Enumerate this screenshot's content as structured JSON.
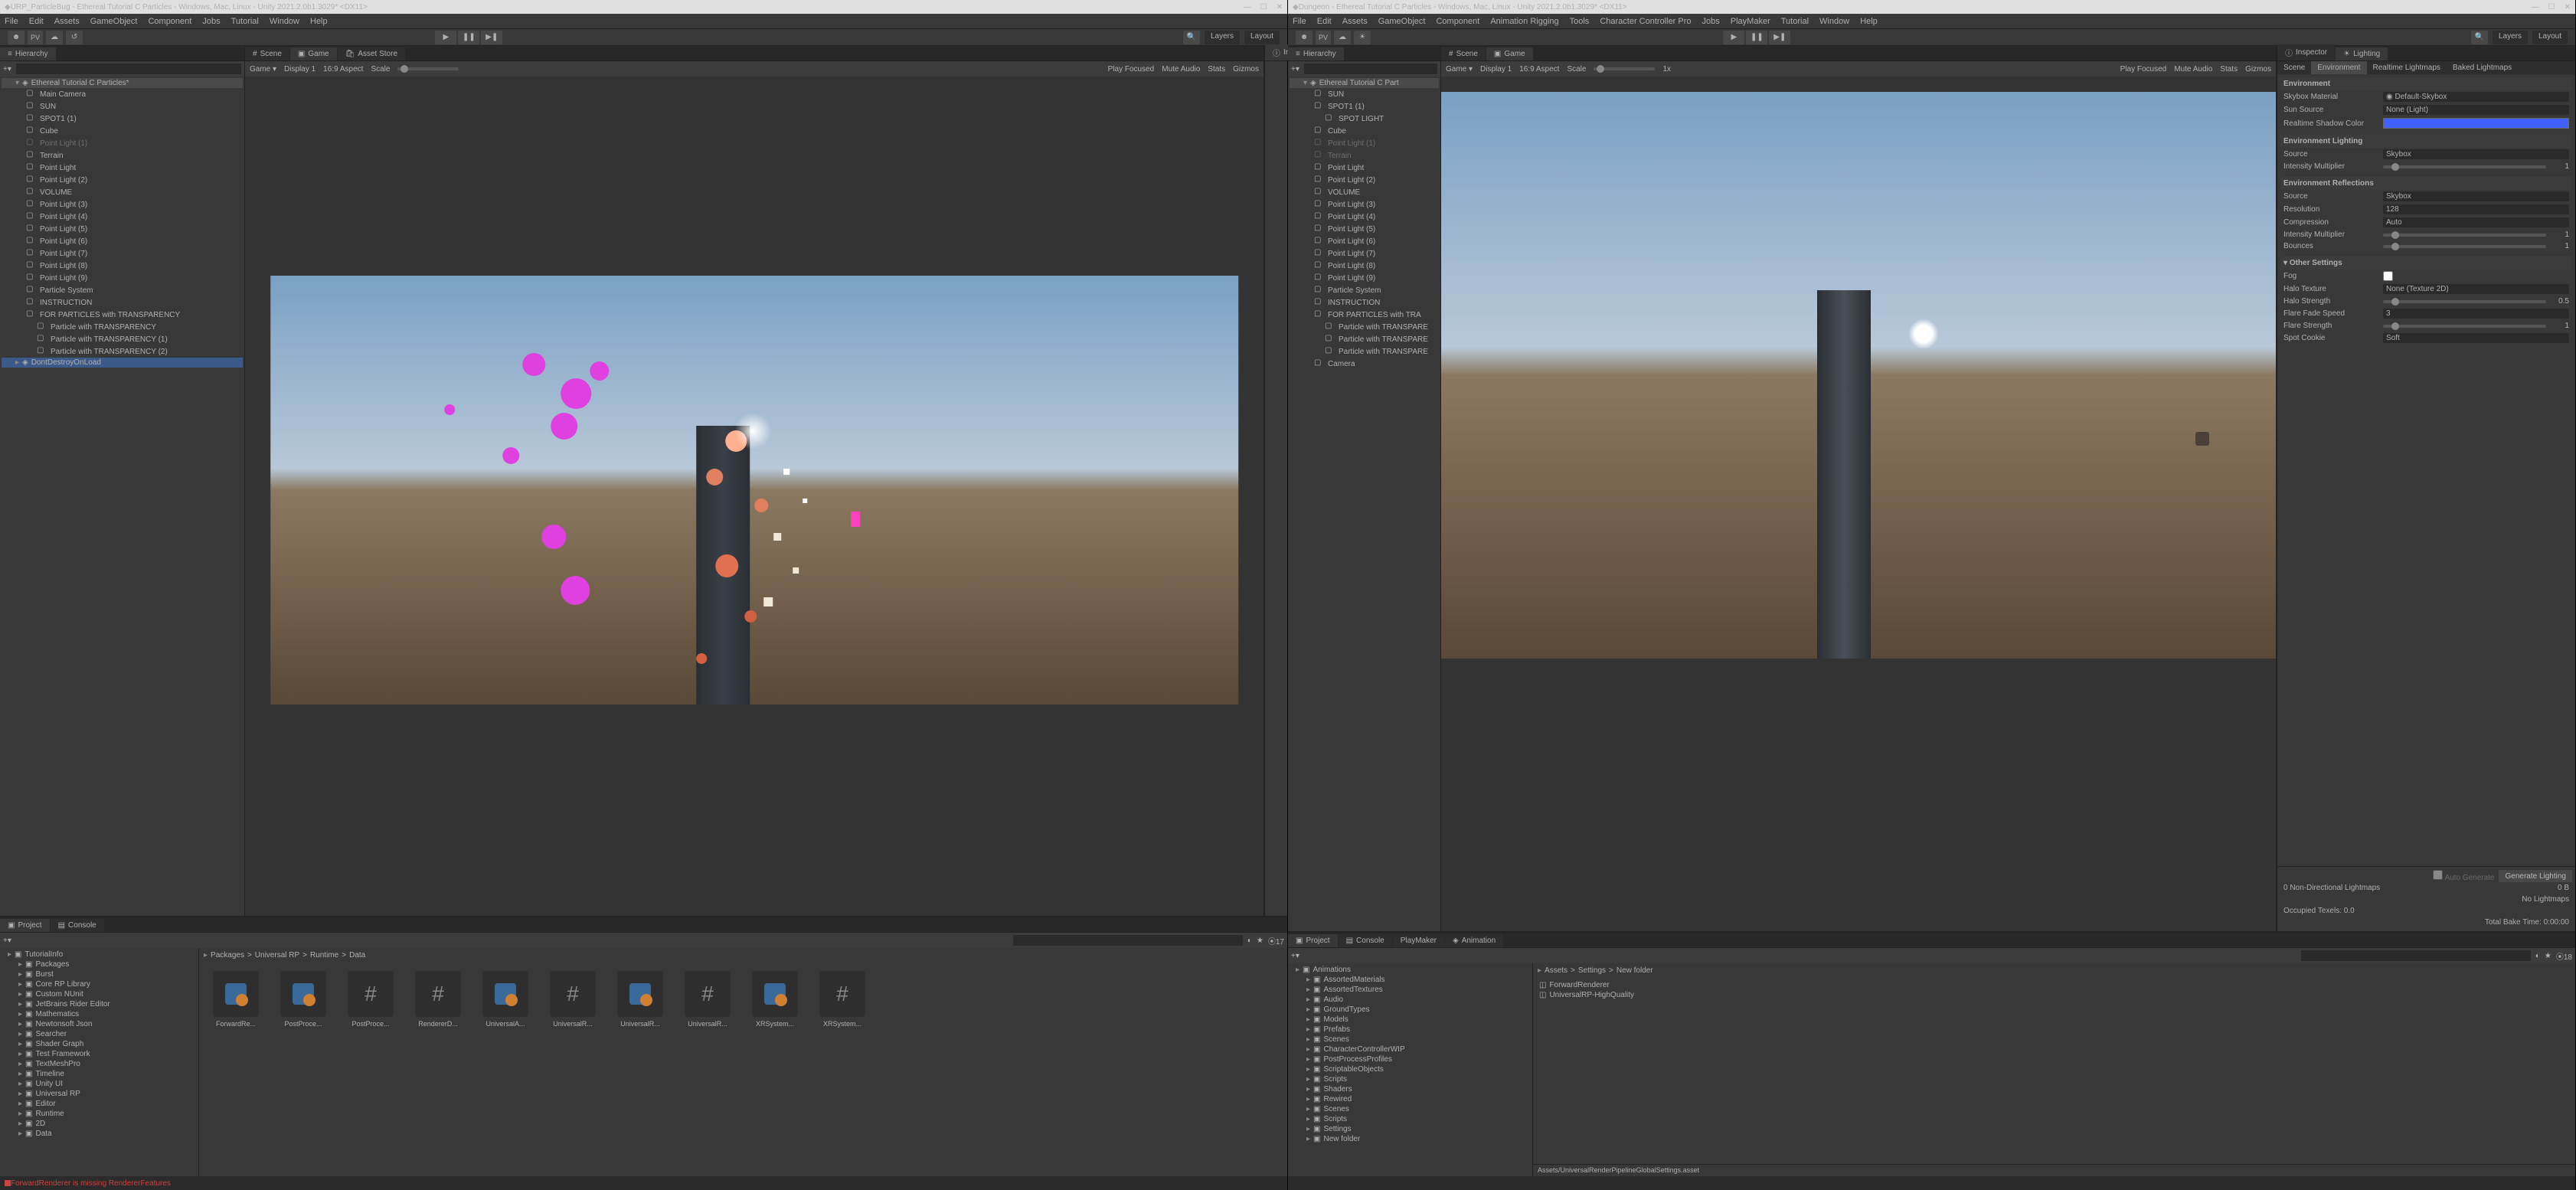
{
  "left": {
    "title": "URP_ParticleBug - Ethereal Tutorial C Particles - Windows, Mac, Linux - Unity 2021.2.0b1.3029* <DX11>",
    "menu": [
      "File",
      "Edit",
      "Assets",
      "GameObject",
      "Component",
      "Jobs",
      "Tutorial",
      "Window",
      "Help"
    ],
    "toolbar_right": {
      "layers": "Layers",
      "layout": "Layout"
    },
    "hierarchy": {
      "tab": "Hierarchy",
      "scene": "Ethereal Tutorial C Particles*",
      "items": [
        {
          "txt": "Main Camera",
          "l": 2
        },
        {
          "txt": "SUN",
          "l": 2
        },
        {
          "txt": "SPOT1 (1)",
          "l": 2
        },
        {
          "txt": "Cube",
          "l": 2
        },
        {
          "txt": "Point Light (1)",
          "l": 2,
          "dim": true
        },
        {
          "txt": "Terrain",
          "l": 2
        },
        {
          "txt": "Point Light",
          "l": 2
        },
        {
          "txt": "Point Light (2)",
          "l": 2
        },
        {
          "txt": "VOLUME",
          "l": 2
        },
        {
          "txt": "Point Light (3)",
          "l": 2
        },
        {
          "txt": "Point Light (4)",
          "l": 2
        },
        {
          "txt": "Point Light (5)",
          "l": 2
        },
        {
          "txt": "Point Light (6)",
          "l": 2
        },
        {
          "txt": "Point Light (7)",
          "l": 2
        },
        {
          "txt": "Point Light (8)",
          "l": 2
        },
        {
          "txt": "Point Light (9)",
          "l": 2
        },
        {
          "txt": "Particle System",
          "l": 2
        },
        {
          "txt": "INSTRUCTION",
          "l": 2
        },
        {
          "txt": "FOR PARTICLES with TRANSPARENCY",
          "l": 2
        },
        {
          "txt": "Particle with TRANSPARENCY",
          "l": 3
        },
        {
          "txt": "Particle with TRANSPARENCY (1)",
          "l": 3
        },
        {
          "txt": "Particle with TRANSPARENCY (2)",
          "l": 3
        }
      ],
      "dontdestroy": "DontDestroyOnLoad"
    },
    "view": {
      "tabs": [
        "Scene",
        "Game",
        "Asset Store"
      ],
      "toolbar": {
        "display": "Display 1",
        "aspect": "16:9 Aspect",
        "scale": "Scale",
        "play_focused": "Play Focused",
        "mute": "Mute Audio",
        "stats": "Stats",
        "gizmos": "Gizmos"
      }
    },
    "inspector": {
      "tab": "Inspector"
    },
    "project": {
      "tabs": [
        "Project",
        "Console"
      ],
      "breadcrumb": [
        "Packages",
        "Universal RP",
        "Runtime",
        "Data"
      ],
      "tree": [
        "TutorialInfo",
        "Packages",
        "Burst",
        "Core RP Library",
        "Custom NUnit",
        "JetBrains Rider Editor",
        "Mathematics",
        "Newtonsoft Json",
        "Searcher",
        "Shader Graph",
        "Test Framework",
        "TextMeshPro",
        "Timeline",
        "Unity UI",
        "Universal RP",
        "Editor",
        "Runtime",
        "2D",
        "Data"
      ],
      "assets": [
        "ForwardRe...",
        "PostProce...",
        "PostProce...",
        "RendererD...",
        "UniversalA...",
        "UniversalR...",
        "UniversalR...",
        "UniversalR...",
        "XRSystem...",
        "XRSystem..."
      ]
    },
    "status": "ForwardRenderer is missing RendererFeatures"
  },
  "right": {
    "title": "Dungeon - Ethereal Tutorial C Particles - Windows, Mac, Linux - Unity 2021.2.0b1.3029* <DX11>",
    "menu": [
      "File",
      "Edit",
      "Assets",
      "GameObject",
      "Component",
      "Animation Rigging",
      "Tools",
      "Character Controller Pro",
      "Jobs",
      "PlayMaker",
      "Tutorial",
      "Window",
      "Help"
    ],
    "toolbar_right": {
      "layers": "Layers",
      "layout": "Layout"
    },
    "hierarchy": {
      "tab": "Hierarchy",
      "scene": "Ethereal Tutorial C Part",
      "items": [
        {
          "txt": "SUN",
          "l": 2
        },
        {
          "txt": "SPOT1 (1)",
          "l": 2
        },
        {
          "txt": "SPOT LIGHT",
          "l": 3
        },
        {
          "txt": "Cube",
          "l": 2
        },
        {
          "txt": "Point Light (1)",
          "l": 2,
          "dim": true
        },
        {
          "txt": "Terrain",
          "l": 2,
          "dim": true
        },
        {
          "txt": "Point Light",
          "l": 2
        },
        {
          "txt": "Point Light (2)",
          "l": 2
        },
        {
          "txt": "VOLUME",
          "l": 2
        },
        {
          "txt": "Point Light (3)",
          "l": 2
        },
        {
          "txt": "Point Light (4)",
          "l": 2
        },
        {
          "txt": "Point Light (5)",
          "l": 2
        },
        {
          "txt": "Point Light (6)",
          "l": 2
        },
        {
          "txt": "Point Light (7)",
          "l": 2
        },
        {
          "txt": "Point Light (8)",
          "l": 2
        },
        {
          "txt": "Point Light (9)",
          "l": 2
        },
        {
          "txt": "Particle System",
          "l": 2
        },
        {
          "txt": "INSTRUCTION",
          "l": 2
        },
        {
          "txt": "FOR PARTICLES with TRA",
          "l": 2
        },
        {
          "txt": "Particle with TRANSPARE",
          "l": 3
        },
        {
          "txt": "Particle with TRANSPARE",
          "l": 3
        },
        {
          "txt": "Particle with TRANSPARE",
          "l": 3
        },
        {
          "txt": "Camera",
          "l": 2
        }
      ]
    },
    "view": {
      "tabs": [
        "Scene",
        "Game"
      ],
      "toolbar": {
        "display": "Display 1",
        "aspect": "16:9 Aspect",
        "scale": "Scale",
        "play_focused": "Play Focused",
        "mute": "Mute Audio",
        "stats": "Stats",
        "gizmos": "Gizmos"
      }
    },
    "inspector": {
      "tabs": [
        "Inspector",
        "Lighting"
      ],
      "subtabs": [
        "Scene",
        "Environment",
        "Realtime Lightmaps",
        "Baked Lightmaps"
      ],
      "env": {
        "header": "Environment",
        "skybox_mat_label": "Skybox Material",
        "skybox_mat": "Default-Skybox",
        "sun_source_label": "Sun Source",
        "sun_source": "None (Light)",
        "shadow_color_label": "Realtime Shadow Color"
      },
      "env_light": {
        "header": "Environment Lighting",
        "source_label": "Source",
        "source": "Skybox",
        "intensity_label": "Intensity Multiplier",
        "intensity": "1"
      },
      "env_refl": {
        "header": "Environment Reflections",
        "source_label": "Source",
        "source": "Skybox",
        "res_label": "Resolution",
        "res": "128",
        "comp_label": "Compression",
        "comp": "Auto",
        "intensity_label": "Intensity Multiplier",
        "intensity": "1",
        "bounces_label": "Bounces",
        "bounces": "1"
      },
      "other": {
        "header": "Other Settings",
        "fog_label": "Fog",
        "halo_tex_label": "Halo Texture",
        "halo_tex": "None (Texture 2D)",
        "halo_str_label": "Halo Strength",
        "halo_str": "0.5",
        "flare_fade_label": "Flare Fade Speed",
        "flare_fade": "3",
        "flare_str_label": "Flare Strength",
        "flare_str": "1",
        "spot_cookie_label": "Spot Cookie",
        "spot_cookie": "Soft"
      },
      "footer": {
        "auto": "Auto Generate",
        "gen": "Generate Lighting",
        "lm1_label": "0 Non-Directional Lightmaps",
        "lm1_val": "0 B",
        "lm2_label": "",
        "lm2_val": "No Lightmaps",
        "occ_label": "Occupied Texels: 0.0",
        "bake_label": "Total Bake Time: 0:00:00"
      }
    },
    "project": {
      "tabs": [
        "Project",
        "Console",
        "PlayMaker",
        "Animation"
      ],
      "breadcrumb": [
        "Assets",
        "Settings",
        "New folder"
      ],
      "tree": [
        "Animations",
        "AssortedMaterials",
        "AssortedTextures",
        "Audio",
        "GroundTypes",
        "Models",
        "Prefabs",
        "Scenes",
        "CharacterControllerWIP",
        "PostProcessProfiles",
        "ScriptableObjects",
        "Scripts",
        "Shaders",
        "Rewired",
        "Scenes",
        "Scripts",
        "Settings",
        "New folder"
      ],
      "files": [
        "ForwardRenderer",
        "UniversalRP-HighQuality"
      ],
      "footer_path": "Assets/UniversalRenderPipelineGlobalSettings.asset"
    }
  }
}
